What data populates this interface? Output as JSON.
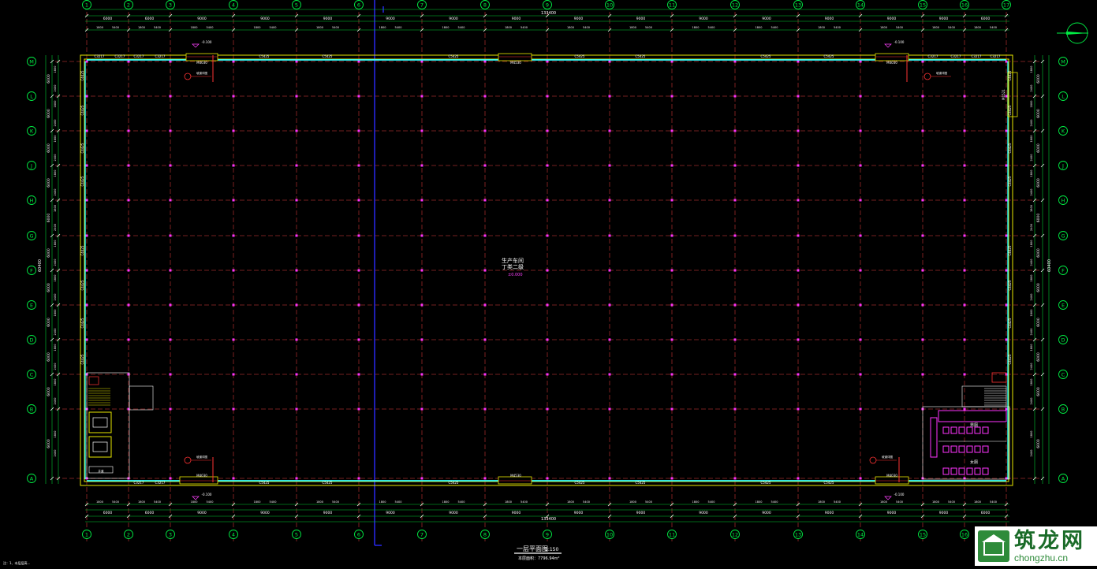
{
  "drawing": {
    "title": "一层平面图",
    "scale": "1:150",
    "area_note": "本层面积：7796.94m²",
    "room_label_line1": "生产车间",
    "room_label_line2": "丁类二级",
    "room_elevation": "±0.000",
    "total_width_label": "133400",
    "total_depth_label": "60400",
    "left_note": "注：1、本层层高..."
  },
  "axes": {
    "columns": [
      "1",
      "2",
      "3",
      "4",
      "5",
      "6",
      "7",
      "8",
      "9",
      "10",
      "11",
      "12",
      "13",
      "14",
      "15",
      "16",
      "17"
    ],
    "rows": [
      "A",
      "B",
      "C",
      "D",
      "E",
      "F",
      "G",
      "H",
      "J",
      "K",
      "L",
      "M"
    ],
    "top_spans": [
      "6000",
      "6000",
      "9000",
      "9000",
      "9000",
      "9000",
      "9000",
      "9000",
      "9000",
      "9000",
      "9000",
      "9000",
      "9000",
      "9000",
      "9000",
      "6000"
    ],
    "row_spans": [
      "6000",
      "6000",
      "6000",
      "6000",
      "6000",
      "6000",
      "6000",
      "6000",
      "6000",
      "6000",
      "6000"
    ]
  },
  "labels": {
    "window_tags": [
      "C3217",
      "C3217",
      "C3217",
      "C3217",
      "C5425",
      "C5425",
      "C5425",
      "C5425",
      "C5425",
      "C5425"
    ],
    "door_tags": [
      "M4030",
      "M4530",
      "M4530",
      "M4030",
      "M1521"
    ],
    "elevation_tags": [
      "-0.100",
      "-0.100",
      "-0.100",
      "-0.100"
    ],
    "wc_male": "男厕",
    "wc_female": "女厕"
  },
  "watermark": {
    "brand_cn": "筑龙网",
    "brand_url": "chongzhu.cn"
  }
}
